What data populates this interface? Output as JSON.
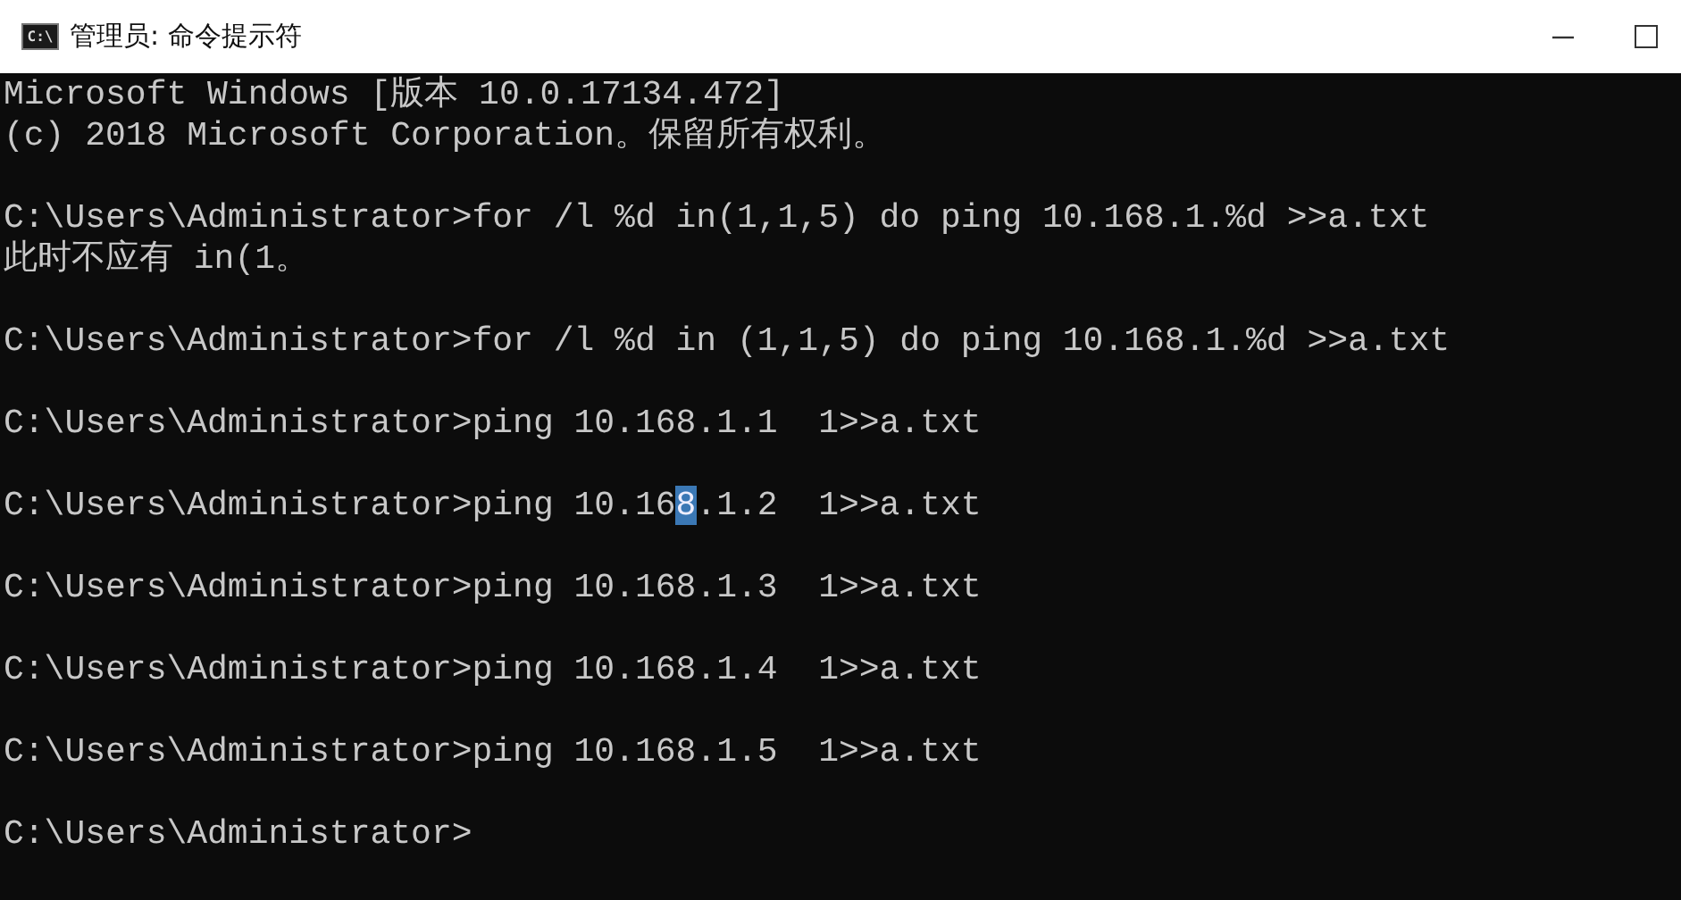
{
  "window": {
    "title": "管理员: 命令提示符",
    "icon_text": "C:\\"
  },
  "console": {
    "blocks": [
      {
        "lines": [
          {
            "text": "Microsoft Windows [版本 10.0.17134.472]"
          },
          {
            "text": "(c) 2018 Microsoft Corporation。保留所有权利。"
          }
        ]
      },
      {
        "lines": [
          {
            "text": "C:\\Users\\Administrator>for /l %d in(1,1,5) do ping 10.168.1.%d >>a.txt"
          },
          {
            "text": "此时不应有 in(1。"
          }
        ]
      },
      {
        "lines": [
          {
            "text": "C:\\Users\\Administrator>for /l %d in (1,1,5) do ping 10.168.1.%d >>a.txt"
          }
        ]
      },
      {
        "lines": [
          {
            "text": "C:\\Users\\Administrator>ping 10.168.1.1  1>>a.txt"
          }
        ]
      },
      {
        "lines": [
          {
            "text": "C:\\Users\\Administrator>ping 10.16",
            "selected_text": "8",
            "text_after": ".1.2  1>>a.txt"
          }
        ]
      },
      {
        "lines": [
          {
            "text": "C:\\Users\\Administrator>ping 10.168.1.3  1>>a.txt"
          }
        ]
      },
      {
        "lines": [
          {
            "text": "C:\\Users\\Administrator>ping 10.168.1.4  1>>a.txt"
          }
        ]
      },
      {
        "lines": [
          {
            "text": "C:\\Users\\Administrator>ping 10.168.1.5  1>>a.txt"
          }
        ]
      },
      {
        "lines": [
          {
            "text": "C:\\Users\\Administrator>"
          }
        ]
      }
    ]
  }
}
